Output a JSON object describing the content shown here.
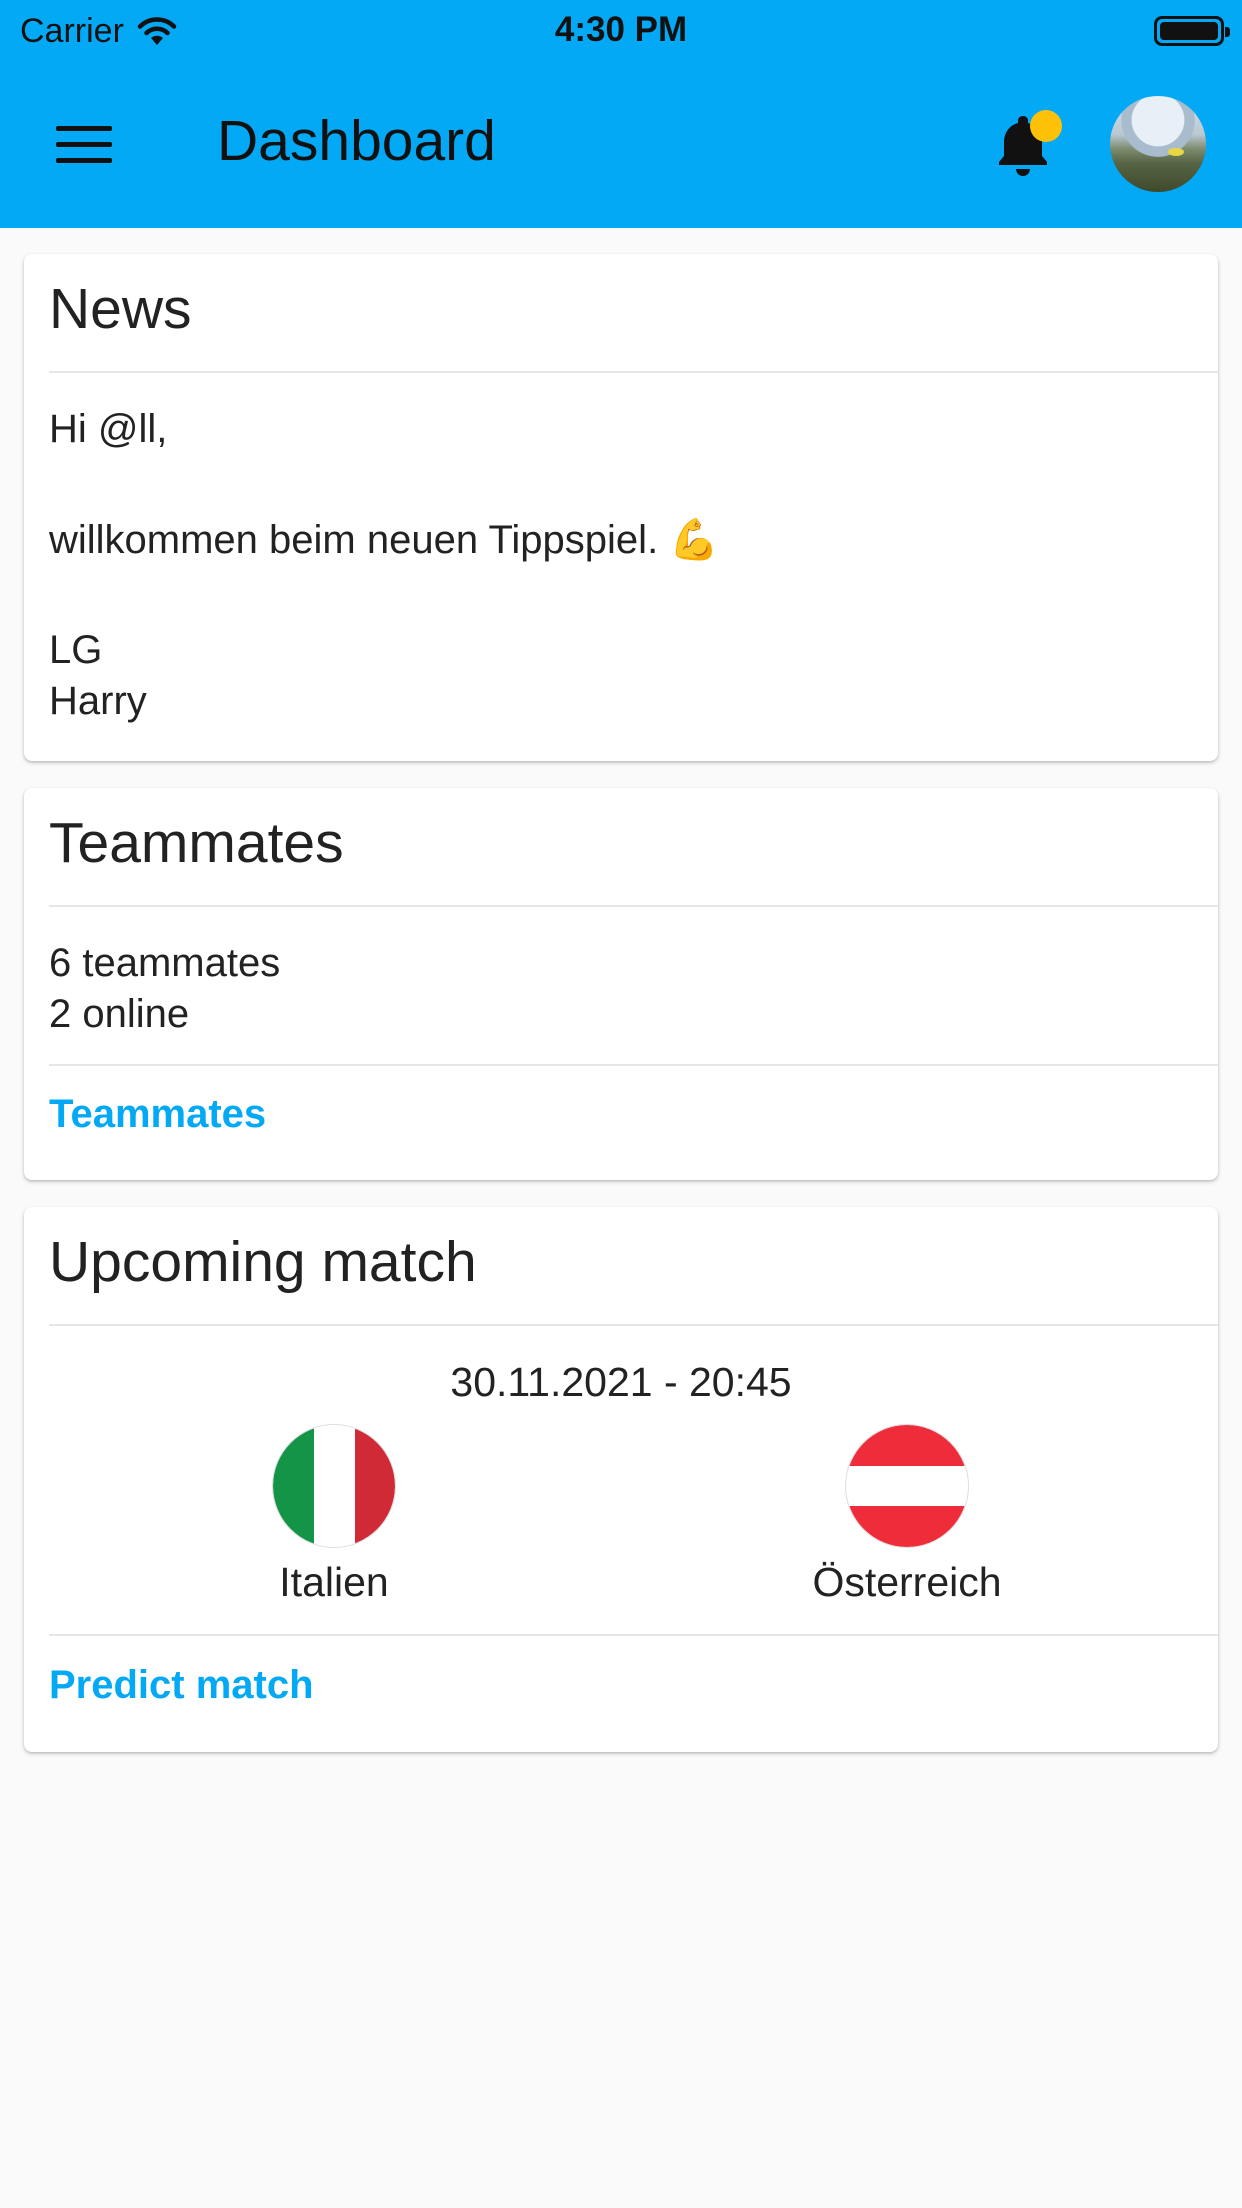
{
  "status_bar": {
    "carrier": "Carrier",
    "time": "4:30 PM"
  },
  "app_bar": {
    "title": "Dashboard",
    "menu_icon": "hamburger-menu-icon",
    "notification_icon": "bell-icon",
    "notification_badge_color": "#ffc107",
    "accent_color": "#03a9f4"
  },
  "news": {
    "title": "News",
    "lines": [
      "Hi @ll,",
      "willkommen beim neuen Tippspiel. 💪",
      "LG",
      "Harry"
    ]
  },
  "teammates": {
    "title": "Teammates",
    "count_text": "6 teammates",
    "online_text": "2 online",
    "link_label": "Teammates"
  },
  "upcoming_match": {
    "title": "Upcoming match",
    "datetime": "30.11.2021 - 20:45",
    "home_team": {
      "name": "Italien",
      "flag_icon": "italy-flag-icon"
    },
    "away_team": {
      "name": "Österreich",
      "flag_icon": "austria-flag-icon"
    },
    "link_label": "Predict match"
  }
}
